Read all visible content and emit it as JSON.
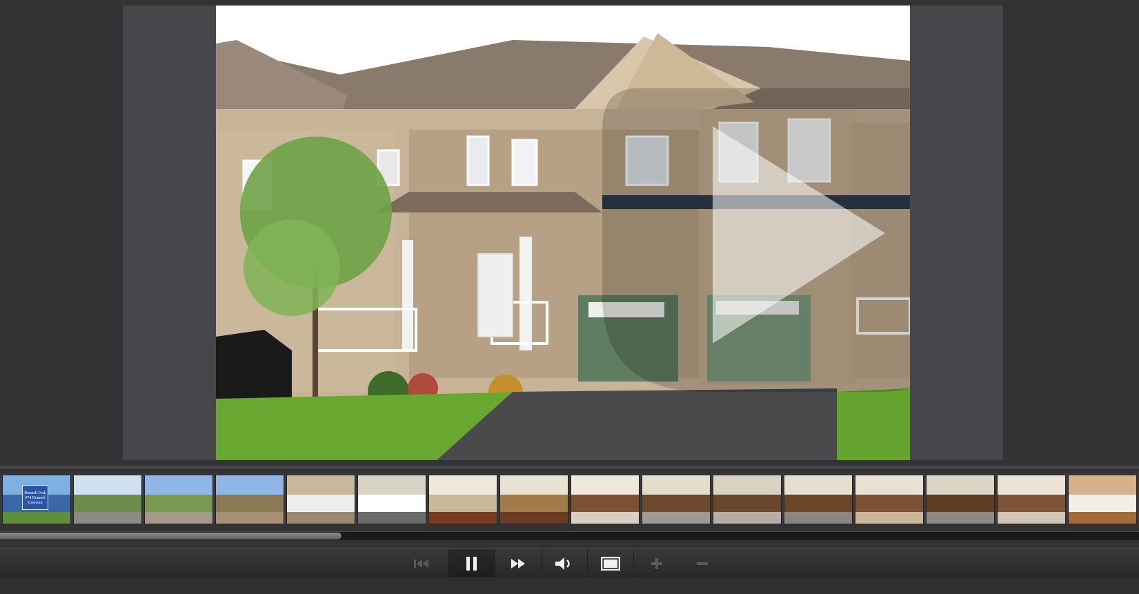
{
  "viewer": {
    "main_photo": {
      "subject": "townhouse-exterior"
    },
    "play_overlay": {
      "icon": "play-icon"
    }
  },
  "filmstrip": {
    "thumbnails": [
      {
        "scene": "park-sign",
        "palette": [
          "#7fb0e0",
          "#3a67a8",
          "#5f8f3a"
        ],
        "sign_text": [
          "Bonnell Park",
          "#74 Bonnell Crescent"
        ]
      },
      {
        "scene": "park-path",
        "palette": [
          "#cfe0ee",
          "#6b8f4a",
          "#8c8a86"
        ]
      },
      {
        "scene": "park-bench",
        "palette": [
          "#8fb6e6",
          "#7a9a4f",
          "#a59a89"
        ]
      },
      {
        "scene": "park-pond",
        "palette": [
          "#8fb6e6",
          "#8a7b55",
          "#a59075"
        ]
      },
      {
        "scene": "front-porch",
        "palette": [
          "#c8b79b",
          "#eeeeee",
          "#9a8a72"
        ]
      },
      {
        "scene": "porch-door",
        "palette": [
          "#d8d2c4",
          "#ffffff",
          "#6b6b6b"
        ]
      },
      {
        "scene": "hallway",
        "palette": [
          "#efe8d8",
          "#c9b99b",
          "#7a3a22"
        ]
      },
      {
        "scene": "foyer",
        "palette": [
          "#e9e2d2",
          "#a37a4a",
          "#6b3a22"
        ]
      },
      {
        "scene": "kitchen-1",
        "palette": [
          "#efe8dd",
          "#7a5233",
          "#d7cfc1"
        ]
      },
      {
        "scene": "kitchen-2",
        "palette": [
          "#e4dccc",
          "#6d4a2e",
          "#9e9a93"
        ]
      },
      {
        "scene": "kitchen-3",
        "palette": [
          "#d9d1c1",
          "#6a472b",
          "#b4aea4"
        ]
      },
      {
        "scene": "kitchen-4",
        "palette": [
          "#e6dfd0",
          "#6b4629",
          "#8a8580"
        ]
      },
      {
        "scene": "kitchen-5",
        "palette": [
          "#e7e0d3",
          "#7a5233",
          "#c9b59a"
        ]
      },
      {
        "scene": "kitchen-6",
        "palette": [
          "#ddd5c6",
          "#5f3e26",
          "#8d8983"
        ]
      },
      {
        "scene": "kitchen-7",
        "palette": [
          "#eae3d6",
          "#7d5536",
          "#cfc6b7"
        ]
      },
      {
        "scene": "dining-room",
        "palette": [
          "#d6b28a",
          "#f4efe6",
          "#a56a3a"
        ]
      }
    ],
    "scroll_position": 0.3
  },
  "controls": {
    "buttons": [
      {
        "name": "previous-button",
        "icon": "skip-back-icon",
        "enabled": false
      },
      {
        "name": "pause-button",
        "icon": "pause-icon",
        "enabled": true,
        "active": true
      },
      {
        "name": "next-button",
        "icon": "fast-forward-icon",
        "enabled": true
      },
      {
        "name": "volume-button",
        "icon": "speaker-icon",
        "enabled": true
      },
      {
        "name": "fullscreen-button",
        "icon": "fullscreen-icon",
        "enabled": true
      },
      {
        "name": "zoom-in-button",
        "icon": "plus-icon",
        "enabled": false
      },
      {
        "name": "zoom-out-button",
        "icon": "minus-icon",
        "enabled": false
      }
    ]
  },
  "colors": {
    "background": "#333335",
    "stage": "#47464b",
    "icon_enabled": "#f2f2f2",
    "icon_disabled": "#5a5a5c"
  }
}
